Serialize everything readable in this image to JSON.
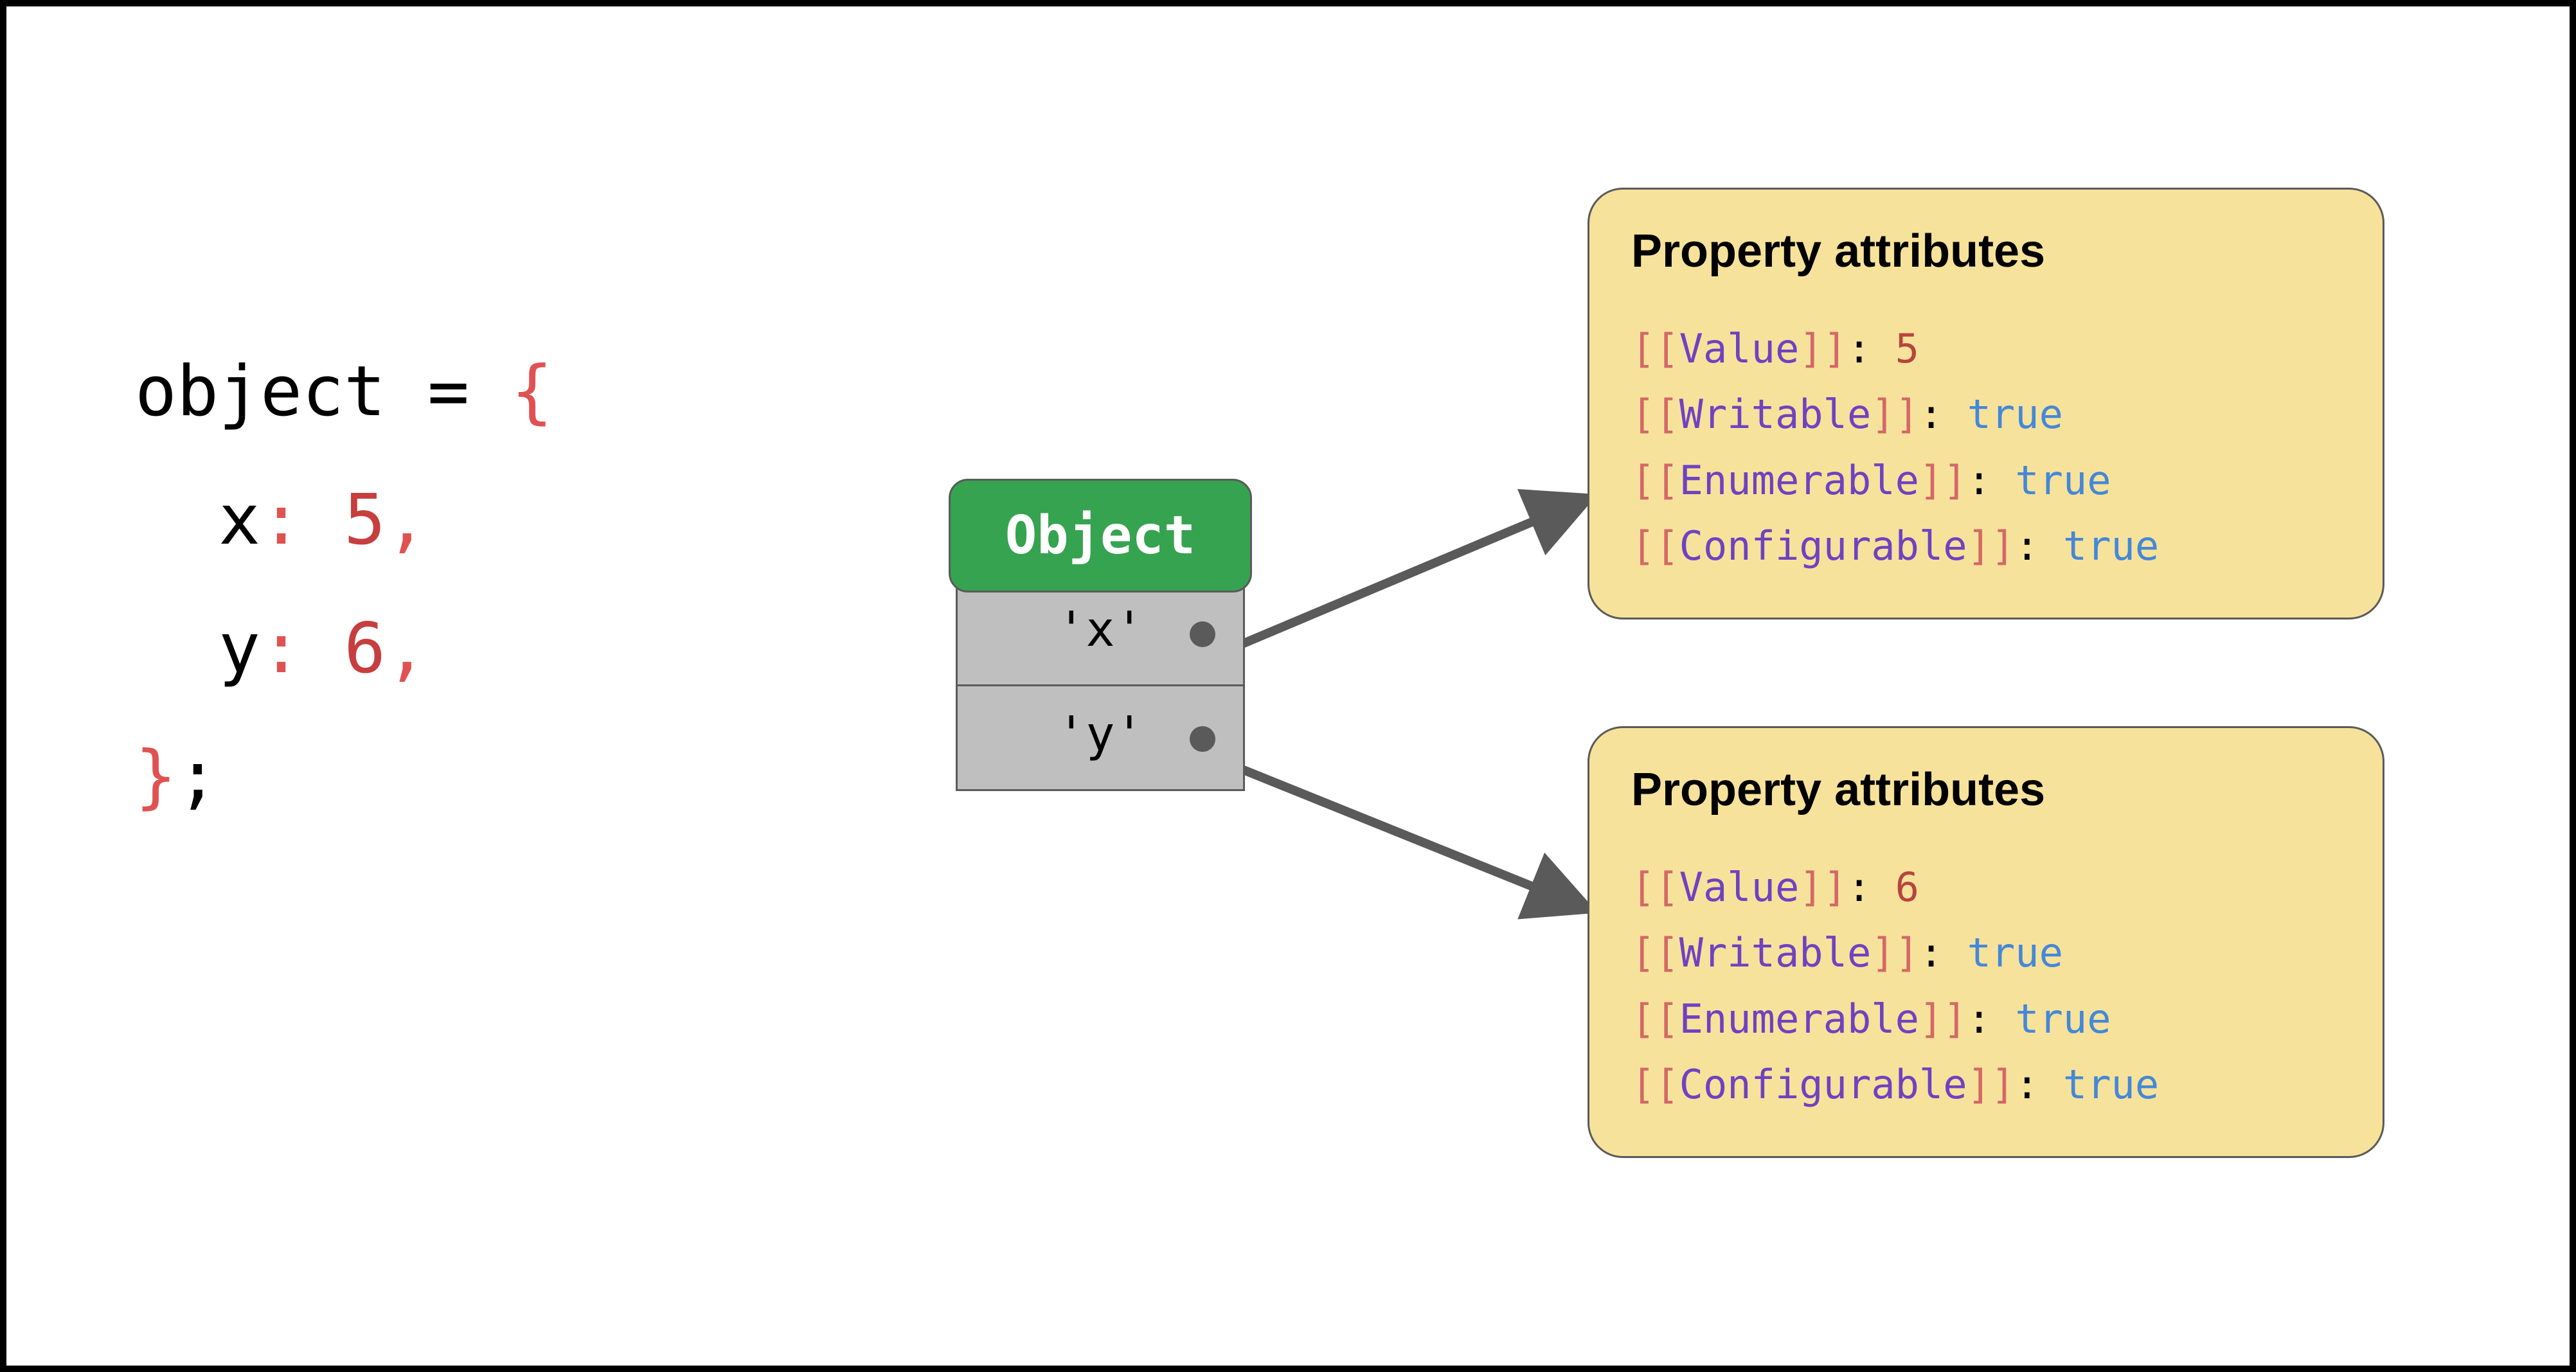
{
  "code": {
    "word_object": "object",
    "equals": " = ",
    "brace_open": "{",
    "line_x_key": "  x",
    "line_x_colon": ": ",
    "line_x_val": "5",
    "line_x_comma": ",",
    "line_y_key": "  y",
    "line_y_colon": ": ",
    "line_y_val": "6",
    "line_y_comma": ",",
    "brace_close": "}",
    "semicolon": ";"
  },
  "object_diagram": {
    "header": "Object",
    "row_x": "'x'",
    "row_y": "'y'"
  },
  "attrs": {
    "title": "Property attributes",
    "box1": {
      "value_label": "Value",
      "value": "5",
      "writable_label": "Writable",
      "writable": "true",
      "enumerable_label": "Enumerable",
      "enumerable": "true",
      "configurable_label": "Configurable",
      "configurable": "true"
    },
    "box2": {
      "value_label": "Value",
      "value": "6",
      "writable_label": "Writable",
      "writable": "true",
      "enumerable_label": "Enumerable",
      "enumerable": "true",
      "configurable_label": "Configurable",
      "configurable": "true"
    }
  },
  "syntax": {
    "open_br": "[[",
    "close_br": "]]",
    "colon_sp": ": "
  }
}
